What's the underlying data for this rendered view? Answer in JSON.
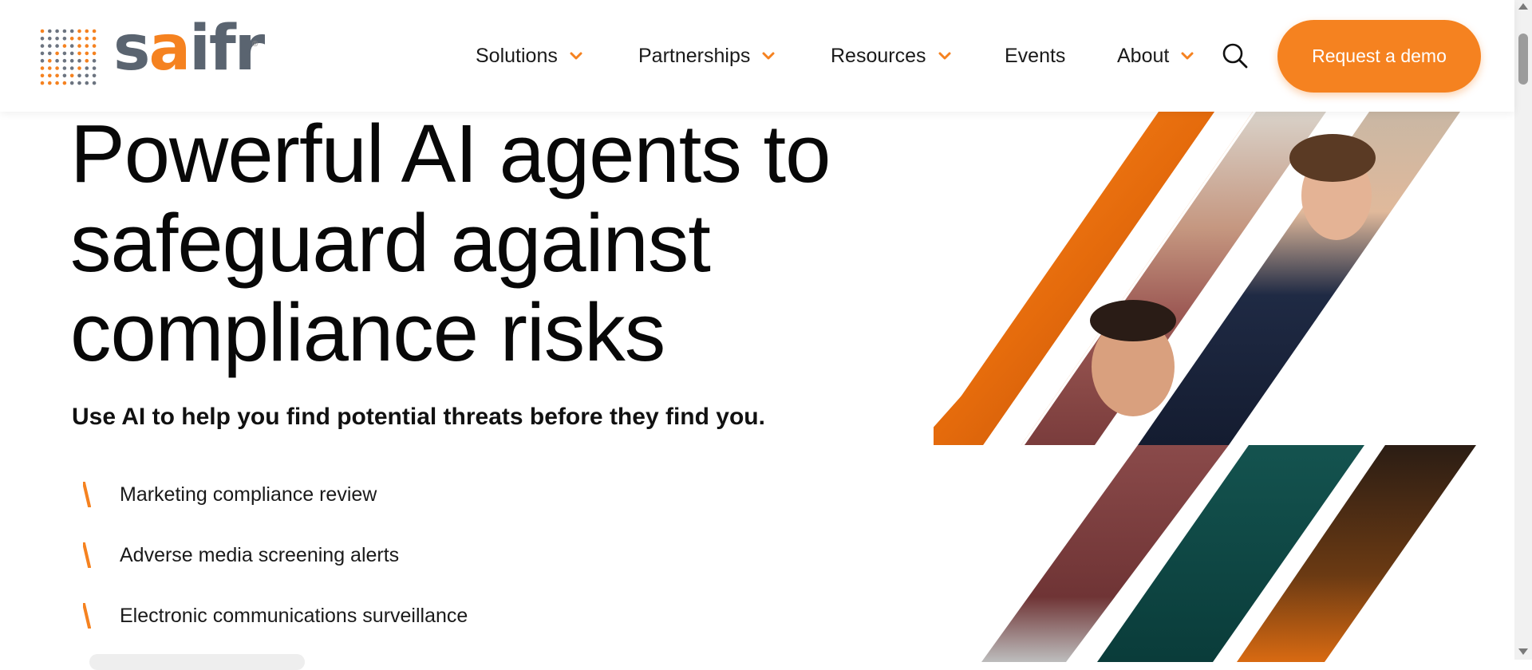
{
  "brand": {
    "name": "saifr",
    "registered_mark": "®",
    "accent_color": "#f58220",
    "wordmark_color": "#5a6470"
  },
  "nav": {
    "items": [
      {
        "label": "Solutions",
        "has_dropdown": true
      },
      {
        "label": "Partnerships",
        "has_dropdown": true
      },
      {
        "label": "Resources",
        "has_dropdown": true
      },
      {
        "label": "Events",
        "has_dropdown": false
      },
      {
        "label": "About",
        "has_dropdown": true
      }
    ],
    "search_icon": "search-icon",
    "cta_label": "Request a demo"
  },
  "hero": {
    "title_lines": [
      "Powerful AI agents to",
      "safeguard against",
      "compliance risks"
    ],
    "subtitle": "Use AI to help you find potential threats before they find you.",
    "features": [
      "Marketing compliance review",
      "Adverse media screening alerts",
      "Electronic communications surveillance"
    ]
  },
  "imagery": {
    "description_icon": "people-collage-image",
    "colors": [
      "#f58220",
      "#0e6b67",
      "#8a4a4a",
      "#1f2a44"
    ]
  }
}
